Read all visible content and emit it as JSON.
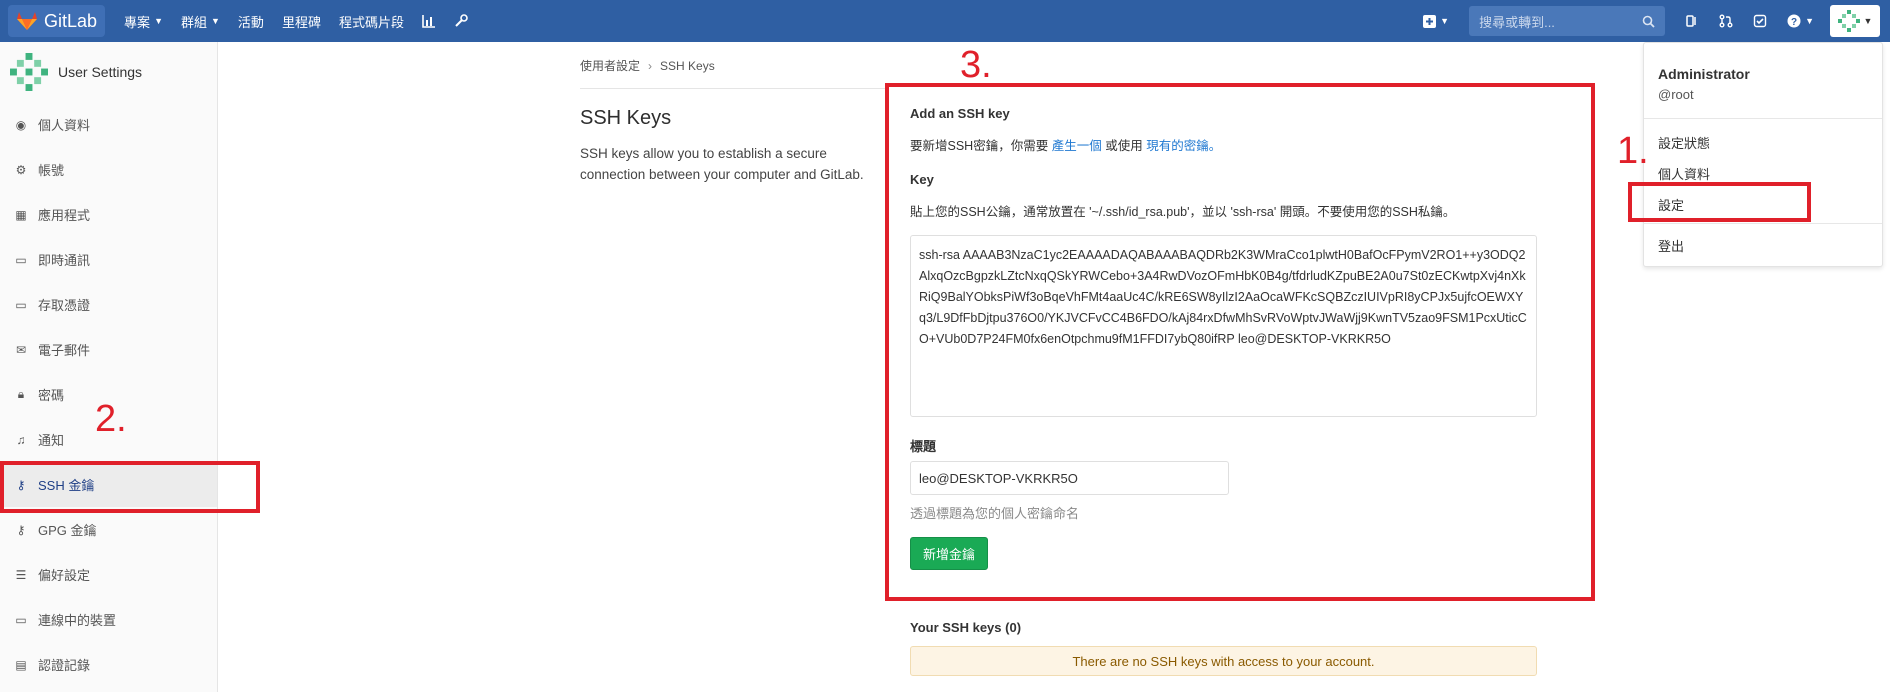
{
  "navbar": {
    "brand": "GitLab",
    "items": [
      {
        "label": "專案",
        "caret": true
      },
      {
        "label": "群組",
        "caret": true
      },
      {
        "label": "活動",
        "caret": false
      },
      {
        "label": "里程碑",
        "caret": false
      },
      {
        "label": "程式碼片段",
        "caret": false
      }
    ],
    "search_placeholder": "搜尋或轉到...",
    "brand_color": "#2f5fa3"
  },
  "sidebar": {
    "title": "User Settings",
    "items": [
      {
        "label": "個人資料",
        "icon": "profile-icon"
      },
      {
        "label": "帳號",
        "icon": "account-icon"
      },
      {
        "label": "應用程式",
        "icon": "applications-icon"
      },
      {
        "label": "即時通訊",
        "icon": "chat-icon"
      },
      {
        "label": "存取憑證",
        "icon": "token-icon"
      },
      {
        "label": "電子郵件",
        "icon": "email-icon"
      },
      {
        "label": "密碼",
        "icon": "lock-icon"
      },
      {
        "label": "通知",
        "icon": "bell-icon"
      },
      {
        "label": "SSH 金鑰",
        "icon": "key-icon"
      },
      {
        "label": "GPG 金鑰",
        "icon": "key-icon"
      },
      {
        "label": "偏好設定",
        "icon": "preferences-icon"
      },
      {
        "label": "連線中的裝置",
        "icon": "monitor-icon"
      },
      {
        "label": "認證記錄",
        "icon": "log-icon"
      }
    ]
  },
  "breadcrumb": {
    "parent": "使用者設定",
    "current": "SSH Keys"
  },
  "page": {
    "title": "SSH Keys",
    "description": "SSH keys allow you to establish a secure connection between your computer and GitLab."
  },
  "form": {
    "add_heading": "Add an SSH key",
    "intro_prefix": "要新增SSH密鑰，你需要",
    "intro_link1": "產生一個",
    "intro_middle": "或使用",
    "intro_link2": "現有的密鑰",
    "intro_suffix": "。",
    "key_label": "Key",
    "key_help": "貼上您的SSH公鑰，通常放置在 '~/.ssh/id_rsa.pub'，並以 'ssh-rsa' 開頭。不要使用您的SSH私鑰。",
    "key_value": "ssh-rsa AAAAB3NzaC1yc2EAAAADAQABAAABAQDRb2K3WMraCco1plwtH0BafOcFPymV2RO1++y3ODQ2AlxqOzcBgpzkLZtcNxqQSkYRWCebo+3A4RwDVozOFmHbK0B4g/tfdrludKZpuBE2A0u7St0zECKwtpXvj4nXkRiQ9BalYObksPiWf3oBqeVhFMt4aaUc4C/kRE6SW8yIlzI2AaOcaWFKcSQBZczIUIVpRI8yCPJx5ujfcOEWXYq3/L9DfFbDjtpu376O0/YKJVCFvCC4B6FDO/kAj84rxDfwMhSvRVoWptvJWaWjj9KwnTV5zao9FSM1PcxUticCO+VUb0D7P24FM0fx6enOtpchmu9fM1FFDI7ybQ80ifRP leo@DESKTOP-VKRKR5O",
    "title_label": "標題",
    "title_value": "leo@DESKTOP-VKRKR5O",
    "title_hint": "透過標題為您的個人密鑰命名",
    "submit_label": "新增金鑰",
    "your_keys_label": "Your SSH keys (0)",
    "no_keys_message": "There are no SSH keys with access to your account."
  },
  "dropdown": {
    "name": "Administrator",
    "username": "@root",
    "items": [
      "設定狀態",
      "個人資料",
      "設定",
      "登出"
    ]
  },
  "annotations": {
    "step1": "1.",
    "step2": "2.",
    "step3": "3.",
    "color": "#e0202a"
  }
}
